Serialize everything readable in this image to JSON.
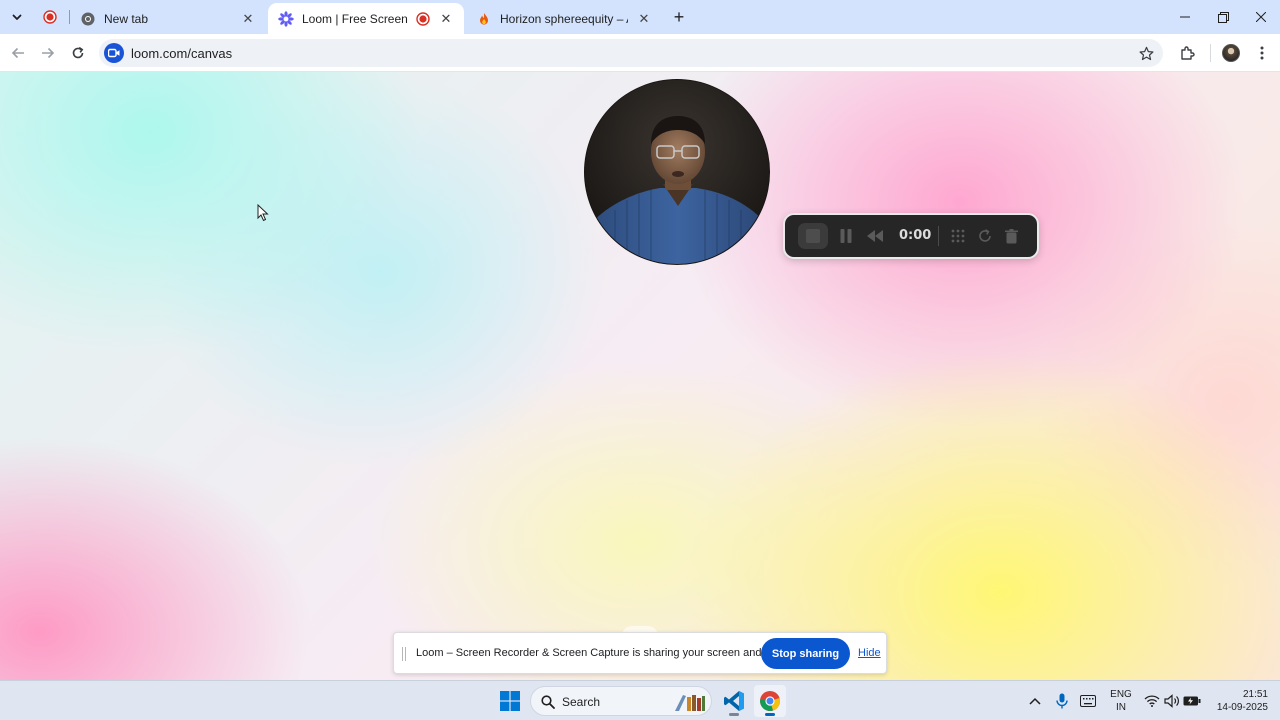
{
  "browser": {
    "tabs": [
      {
        "title": "New tab",
        "favicon": "chrome-icon",
        "active": false
      },
      {
        "title": "Loom | Free Screen & Video Recording",
        "favicon": "loom-icon",
        "active": true,
        "recording": true
      },
      {
        "title": "Horizon sphereequity – Authentication",
        "favicon": "flame-icon",
        "active": false
      }
    ],
    "address": {
      "url": "loom.com/canvas",
      "site_icon": "video-camera-icon"
    }
  },
  "recorder": {
    "timer": "0:00",
    "controls": [
      "stop-icon",
      "pause-icon",
      "rewind-icon",
      "timer",
      "grid-icon",
      "restart-icon",
      "delete-icon"
    ]
  },
  "share_bar": {
    "message": "Loom – Screen Recorder & Screen Capture is sharing your screen and audio.",
    "stop_label": "Stop sharing",
    "hide_label": "Hide"
  },
  "taskbar": {
    "search_label": "Search",
    "language_line1": "ENG",
    "language_line2": "IN",
    "time": "21:51",
    "date": "14-09-2025"
  },
  "colors": {
    "accent_blue": "#0b57d0",
    "tabstrip_bg": "#d3e3fd",
    "record_red": "#d93025",
    "control_bg": "#262626"
  }
}
